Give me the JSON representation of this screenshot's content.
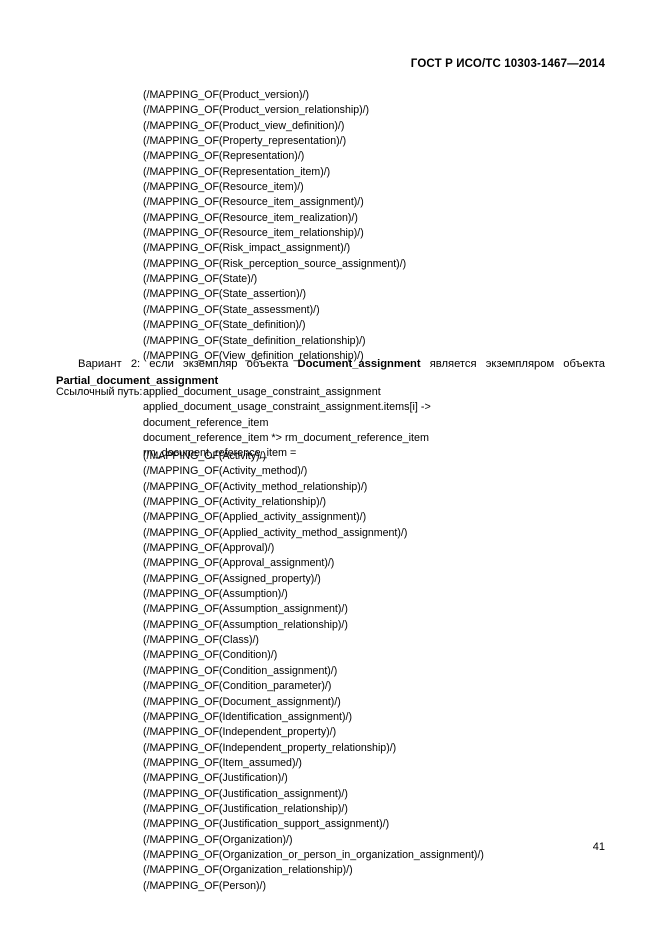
{
  "header": {
    "standard_title": "ГОСТ Р ИСО/ТС 10303-1467—2014"
  },
  "mapping_block_1": {
    "lines": [
      "(/MAPPING_OF(Product_version)/)",
      "(/MAPPING_OF(Product_version_relationship)/)",
      "(/MAPPING_OF(Product_view_definition)/)",
      "(/MAPPING_OF(Property_representation)/)",
      "(/MAPPING_OF(Representation)/)",
      "(/MAPPING_OF(Representation_item)/)",
      "(/MAPPING_OF(Resource_item)/)",
      "(/MAPPING_OF(Resource_item_assignment)/)",
      "(/MAPPING_OF(Resource_item_realization)/)",
      "(/MAPPING_OF(Resource_item_relationship)/)",
      "(/MAPPING_OF(Risk_impact_assignment)/)",
      "(/MAPPING_OF(Risk_perception_source_assignment)/)",
      "(/MAPPING_OF(State)/)",
      "(/MAPPING_OF(State_assertion)/)",
      "(/MAPPING_OF(State_assessment)/)",
      "(/MAPPING_OF(State_definition)/)",
      "(/MAPPING_OF(State_definition_relationship)/)",
      "(/MAPPING_OF(View_definition_relationship)/)"
    ]
  },
  "variant_paragraph": {
    "prefix": "Вариант 2: если экземпляр объекта ",
    "entity_1": "Document_assignment",
    "middle": " является экземпляром объекта ",
    "entity_2": "Partial_document_assignment"
  },
  "reference_path": {
    "label": "Ссылочный путь:",
    "lines": [
      "applied_document_usage_constraint_assignment",
      "applied_document_usage_constraint_assignment.items[i] ->",
      "document_reference_item",
      "document_reference_item *> rm_document_reference_item",
      "rm_document_reference_item ="
    ]
  },
  "mapping_block_2": {
    "lines": [
      "(/MAPPING_OF(Activity)/)",
      "(/MAPPING_OF(Activity_method)/)",
      "(/MAPPING_OF(Activity_method_relationship)/)",
      "(/MAPPING_OF(Activity_relationship)/)",
      "(/MAPPING_OF(Applied_activity_assignment)/)",
      "(/MAPPING_OF(Applied_activity_method_assignment)/)",
      "(/MAPPING_OF(Approval)/)",
      "(/MAPPING_OF(Approval_assignment)/)",
      "(/MAPPING_OF(Assigned_property)/)",
      "(/MAPPING_OF(Assumption)/)",
      "(/MAPPING_OF(Assumption_assignment)/)",
      "(/MAPPING_OF(Assumption_relationship)/)",
      "(/MAPPING_OF(Class)/)",
      "(/MAPPING_OF(Condition)/)",
      "(/MAPPING_OF(Condition_assignment)/)",
      "(/MAPPING_OF(Condition_parameter)/)",
      "(/MAPPING_OF(Document_assignment)/)",
      "(/MAPPING_OF(Identification_assignment)/)",
      "(/MAPPING_OF(Independent_property)/)",
      "(/MAPPING_OF(Independent_property_relationship)/)",
      "(/MAPPING_OF(Item_assumed)/)",
      "(/MAPPING_OF(Justification)/)",
      "(/MAPPING_OF(Justification_assignment)/)",
      "(/MAPPING_OF(Justification_relationship)/)",
      "(/MAPPING_OF(Justification_support_assignment)/)",
      "(/MAPPING_OF(Organization)/)",
      "(/MAPPING_OF(Organization_or_person_in_organization_assignment)/)",
      "(/MAPPING_OF(Organization_relationship)/)",
      "(/MAPPING_OF(Person)/)"
    ]
  },
  "footer": {
    "page_number": "41"
  }
}
